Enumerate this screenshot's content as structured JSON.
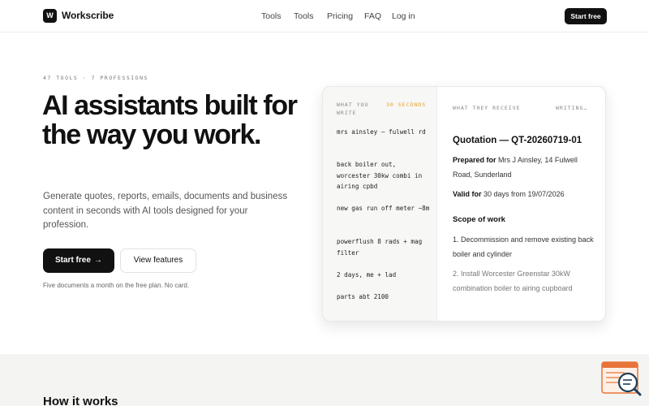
{
  "brand": {
    "logo_letter": "W",
    "name": "Workscribe"
  },
  "nav": {
    "links": [
      {
        "label": "Tools"
      },
      {
        "label": "Tools"
      },
      {
        "label": "Pricing"
      },
      {
        "label": "FAQ"
      },
      {
        "label": "Log in"
      }
    ],
    "cta_label": "Start free"
  },
  "hero": {
    "eyebrow": "47 TOOLS · 7 PROFESSIONS",
    "headline": "AI assistants built for the way you work.",
    "subhead": "Generate quotes, reports, emails, documents and business content in seconds with AI tools designed for your profession.",
    "primary_cta": "Start free",
    "primary_cta_icon": "→",
    "secondary_cta": "View features",
    "fineprint": "Five documents a month on the free plan. No card."
  },
  "demo": {
    "input_label": "WHAT YOU WRITE",
    "timer": "30 SECONDS",
    "output_label": "WHAT THEY RECEIVE",
    "status": "WRITING…",
    "notes": [
      "mrs ainsley — fulwell rd",
      "back boiler out, worcester 30kw combi in airing cpbd",
      "new gas run off meter ~8m",
      "powerflush 8 rads + mag filter",
      "2 days, me + lad",
      "parts abt 2100"
    ],
    "quote": {
      "title": "Quotation — QT-20260719-01",
      "prepared_label": "Prepared for",
      "prepared_value": "Mrs J Ainsley, 14 Fulwell Road, Sunderland",
      "valid_label": "Valid for",
      "valid_value": "30 days from 19/07/2026",
      "scope_heading": "Scope of work",
      "scope_items": [
        "1. Decommission and remove existing back boiler and cylinder",
        "2. Install Worcester Greenstar 30kW combination boiler to airing cupboard"
      ]
    }
  },
  "how_it_works": {
    "title": "How it works"
  },
  "widget": {
    "icon": "search-chat-icon"
  },
  "colors": {
    "accent": "#111111",
    "timer": "#e0a030",
    "widget": "#e8743a"
  }
}
